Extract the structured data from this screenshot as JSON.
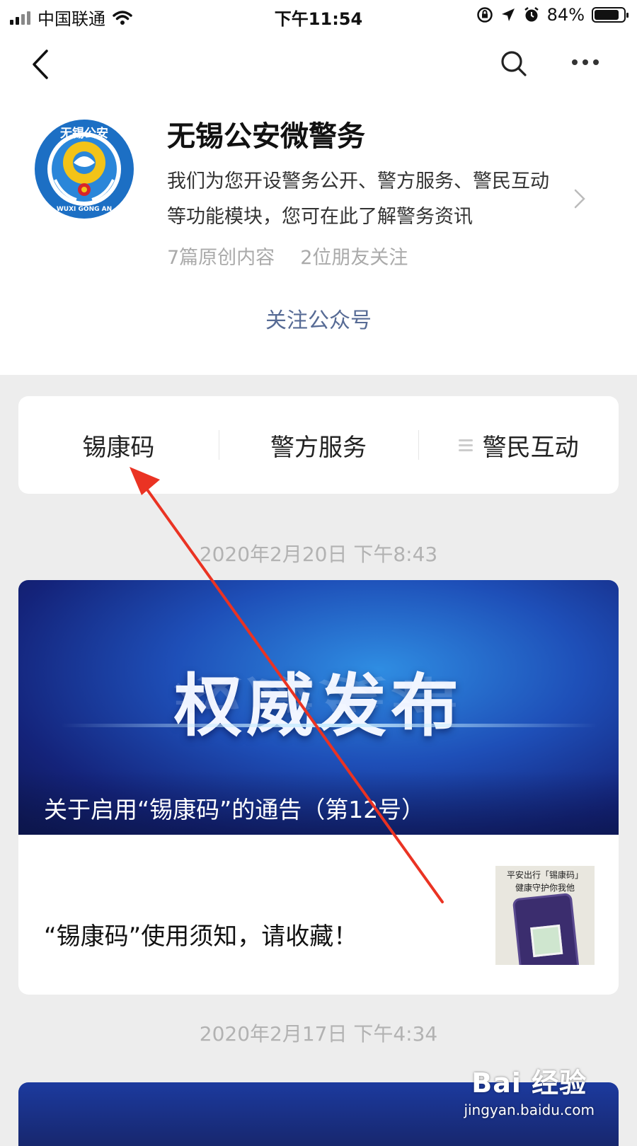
{
  "status_bar": {
    "carrier": "中国联通",
    "time": "下午11:54",
    "battery": "84%",
    "battery_level": 0.84
  },
  "nav": {
    "back_icon": "chevron-left-icon",
    "search_icon": "search-icon",
    "more_icon": "more-dots-icon"
  },
  "account": {
    "logo_ring_text": "无锡公安",
    "logo_bottom_text": "WUXI GONG AN",
    "name": "无锡公安微警务",
    "description": "我们为您开设警务公开、警方服务、警民互动等功能模块，您可在此了解警务资讯",
    "stats_original": "7篇原创内容",
    "stats_friends": "2位朋友关注",
    "follow_button": "关注公众号"
  },
  "menu": {
    "items": [
      {
        "label": "锡康码"
      },
      {
        "label": "警方服务"
      },
      {
        "label": "警民互动",
        "icon": "hamburger-icon"
      }
    ]
  },
  "feed": {
    "posts": [
      {
        "date": "2020年2月20日 下午8:43",
        "banner_headline": "权威发布",
        "banner_title": "关于启用“锡康码”的通告（第12号）",
        "sub_title": "“锡康码”使用须知，请收藏！",
        "thumb_text_line1": "平安出行「锡康码」",
        "thumb_text_line2": "健康守护你我他"
      },
      {
        "date": "2020年2月17日 下午4:34"
      }
    ]
  },
  "watermark": {
    "logo": "Bai 经验",
    "url": "jingyan.baidu.com"
  },
  "colors": {
    "link_blue": "#576b95",
    "annotation_red": "#ea3323",
    "page_gray": "#ededed"
  }
}
